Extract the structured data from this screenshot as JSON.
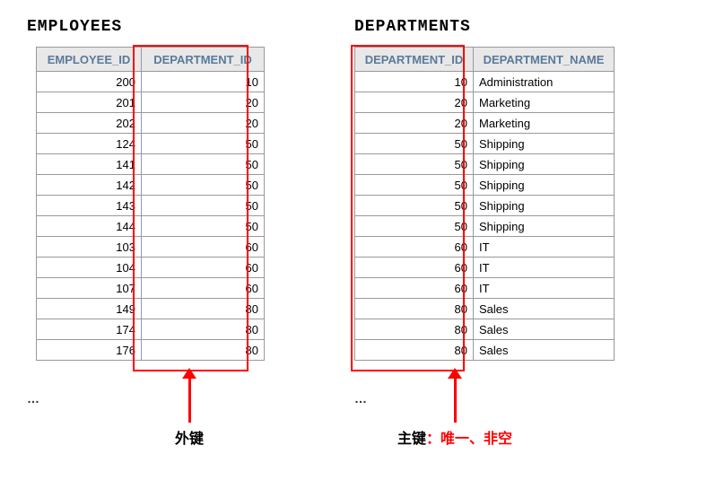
{
  "employees": {
    "title": "EMPLOYEES",
    "columns": [
      "EMPLOYEE_ID",
      "DEPARTMENT_ID"
    ],
    "rows": [
      {
        "eid": "200",
        "did": "10"
      },
      {
        "eid": "201",
        "did": "20"
      },
      {
        "eid": "202",
        "did": "20"
      },
      {
        "eid": "124",
        "did": "50"
      },
      {
        "eid": "141",
        "did": "50"
      },
      {
        "eid": "142",
        "did": "50"
      },
      {
        "eid": "143",
        "did": "50"
      },
      {
        "eid": "144",
        "did": "50"
      },
      {
        "eid": "103",
        "did": "60"
      },
      {
        "eid": "104",
        "did": "60"
      },
      {
        "eid": "107",
        "did": "60"
      },
      {
        "eid": "149",
        "did": "80"
      },
      {
        "eid": "174",
        "did": "80"
      },
      {
        "eid": "176",
        "did": "80"
      }
    ],
    "ellipsis": "…",
    "annotation": "外键"
  },
  "departments": {
    "title": "DEPARTMENTS",
    "columns": [
      "DEPARTMENT_ID",
      "DEPARTMENT_NAME"
    ],
    "rows": [
      {
        "did": "10",
        "name": "Administration"
      },
      {
        "did": "20",
        "name": "Marketing"
      },
      {
        "did": "20",
        "name": "Marketing"
      },
      {
        "did": "50",
        "name": "Shipping"
      },
      {
        "did": "50",
        "name": "Shipping"
      },
      {
        "did": "50",
        "name": "Shipping"
      },
      {
        "did": "50",
        "name": "Shipping"
      },
      {
        "did": "50",
        "name": "Shipping"
      },
      {
        "did": "60",
        "name": "IT"
      },
      {
        "did": "60",
        "name": "IT"
      },
      {
        "did": "60",
        "name": "IT"
      },
      {
        "did": "80",
        "name": "Sales"
      },
      {
        "did": "80",
        "name": "Sales"
      },
      {
        "did": "80",
        "name": "Sales"
      }
    ],
    "ellipsis": "…",
    "annotation_black": "主键",
    "annotation_red": "：唯一、非空"
  }
}
